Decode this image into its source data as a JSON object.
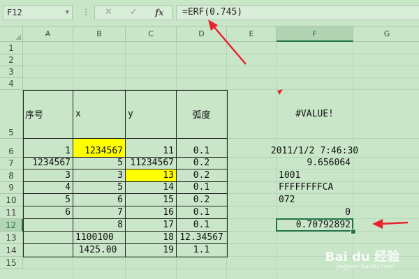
{
  "formula_bar": {
    "name_box": "F12",
    "cancel_icon": "✕",
    "enter_icon": "✓",
    "fx_label": "fx",
    "formula": "=ERF(0.745)"
  },
  "columns": [
    "A",
    "B",
    "C",
    "D",
    "E",
    "F",
    "G"
  ],
  "selected_column": "F",
  "rows": [
    "1",
    "2",
    "3",
    "4",
    "5",
    "6",
    "7",
    "8",
    "9",
    "10",
    "11",
    "12",
    "13",
    "14",
    "15"
  ],
  "selected_row": "12",
  "cells": {
    "A5": "序号",
    "B5": "x",
    "C5": "y",
    "D5": "弧度",
    "F5": "#VALUE!",
    "A6": "1",
    "B6": "1234567",
    "C6": "11",
    "D6": "0.1",
    "F6": "2011/1/2 7:46:30",
    "A7": "1234567",
    "B7": "5",
    "C7": "11234567",
    "D7": "0.2",
    "F7": "9.656064",
    "A8": "3",
    "B8": "3",
    "C8": "13",
    "D8": "0.2",
    "F8": "1001",
    "A9": "4",
    "B9": "5",
    "C9": "14",
    "D9": "0.1",
    "F9": "FFFFFFFFCA",
    "A10": "5",
    "B10": "6",
    "C10": "15",
    "D10": "0.2",
    "F10": "072",
    "A11": "6",
    "B11": "7",
    "C11": "16",
    "D11": "0.1",
    "F11": "0",
    "B12": "8",
    "C12": "17",
    "D12": "0.1",
    "F12": "0.70792892",
    "B13": "1100100",
    "C13": "18",
    "D13": "12.34567",
    "B14": "1425.00",
    "C14": "19",
    "D14": "1.1"
  },
  "colors": {
    "grid_bg": "#c9e6c9",
    "highlight": "#ffff00",
    "selection": "#217346",
    "annotation_arrow": "#e8232a"
  },
  "watermark": {
    "brand": "Bai du 经验",
    "sub": "jingyan.baidu.com"
  }
}
